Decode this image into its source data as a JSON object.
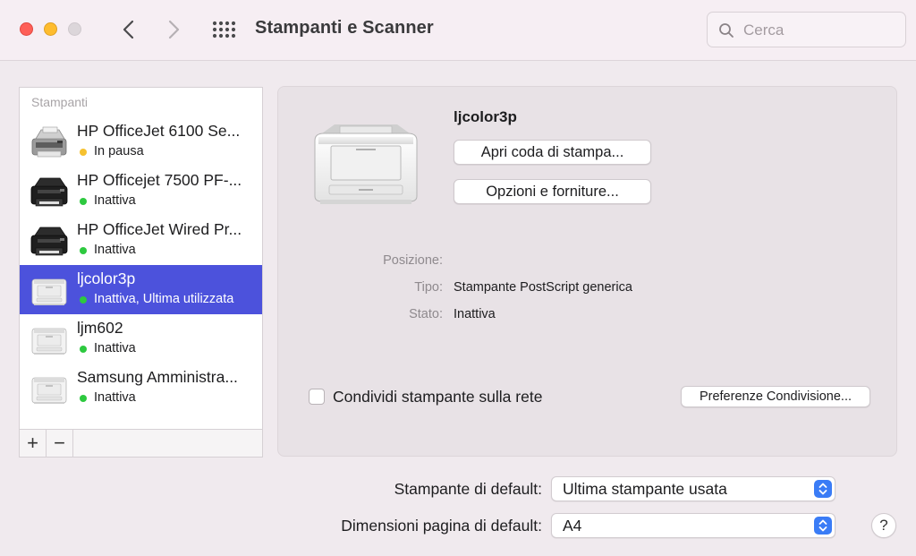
{
  "window": {
    "title": "Stampanti e Scanner",
    "search_placeholder": "Cerca"
  },
  "sidebar": {
    "header": "Stampanti",
    "printers": [
      {
        "name": "HP OfficeJet 6100 Se...",
        "status": "In pausa",
        "status_color": "#f6c12f",
        "icon": "inkjet-gray-printer-icon",
        "selected": false
      },
      {
        "name": "HP Officejet 7500 PF-...",
        "status": "Inattiva",
        "status_color": "#2dc93f",
        "icon": "inkjet-black-printer-icon",
        "selected": false
      },
      {
        "name": "HP OfficeJet Wired Pr...",
        "status": "Inattiva",
        "status_color": "#2dc93f",
        "icon": "inkjet-black-printer-icon",
        "selected": false
      },
      {
        "name": "ljcolor3p",
        "status": "Inattiva, Ultima utilizzata",
        "status_color": "#2dc93f",
        "icon": "laser-printer-icon",
        "selected": true
      },
      {
        "name": "ljm602",
        "status": "Inattiva",
        "status_color": "#2dc93f",
        "icon": "laser-printer-icon",
        "selected": false
      },
      {
        "name": "Samsung Amministra...",
        "status": "Inattiva",
        "status_color": "#2dc93f",
        "icon": "laser-printer-icon",
        "selected": false
      }
    ],
    "add_label": "+",
    "remove_label": "−"
  },
  "detail": {
    "printer_name": "ljcolor3p",
    "open_queue_label": "Apri coda di stampa...",
    "options_label": "Opzioni e forniture...",
    "location_label": "Posizione:",
    "location_value": "",
    "type_label": "Tipo:",
    "type_value": "Stampante PostScript generica",
    "state_label": "Stato:",
    "state_value": "Inattiva",
    "share_label": "Condividi stampante sulla rete",
    "share_checked": false,
    "share_prefs_label": "Preferenze Condivisione..."
  },
  "defaults": {
    "printer_label": "Stampante di default:",
    "printer_value": "Ultima stampante usata",
    "paper_label": "Dimensioni pagina di default:",
    "paper_value": "A4"
  },
  "help_label": "?",
  "colors": {
    "selection": "#4c52dc",
    "accent": "#3a7cf6",
    "status_paused": "#f6c12f",
    "status_idle": "#2dc93f"
  }
}
